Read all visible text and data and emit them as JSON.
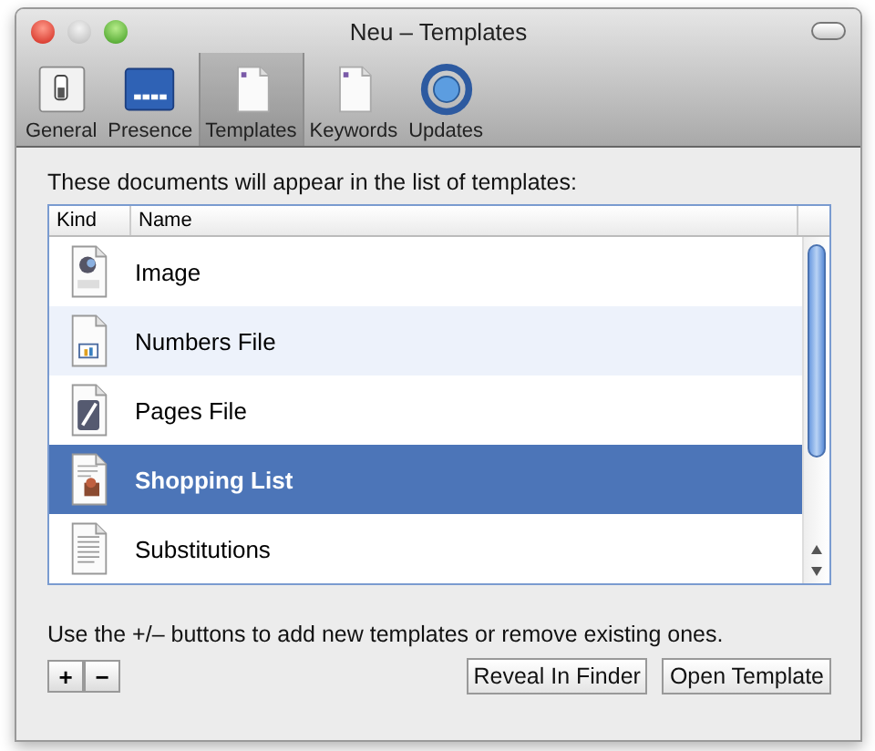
{
  "window": {
    "title": "Neu – Templates"
  },
  "toolbar": [
    {
      "label": "General",
      "kind": "switch",
      "selected": false
    },
    {
      "label": "Presence",
      "kind": "screen",
      "selected": false
    },
    {
      "label": "Templates",
      "kind": "document",
      "selected": true
    },
    {
      "label": "Keywords",
      "kind": "document",
      "selected": false
    },
    {
      "label": "Updates",
      "kind": "globe",
      "selected": false
    }
  ],
  "intro": "These documents will appear in the list of templates:",
  "table": {
    "columns": [
      "Kind",
      "Name"
    ],
    "rows": [
      {
        "kind": "png",
        "name": "Image",
        "selected": false
      },
      {
        "kind": "numbers",
        "name": "Numbers File",
        "selected": false
      },
      {
        "kind": "pages",
        "name": "Pages File",
        "selected": false
      },
      {
        "kind": "illustrated",
        "name": "Shopping List",
        "selected": true
      },
      {
        "kind": "text",
        "name": "Substitutions",
        "selected": false
      }
    ]
  },
  "hint": "Use the +/– buttons to add new templates or remove existing ones.",
  "add_button": "+",
  "remove_button": "−",
  "buttons": [
    "Reveal In Finder",
    "Open Template"
  ]
}
